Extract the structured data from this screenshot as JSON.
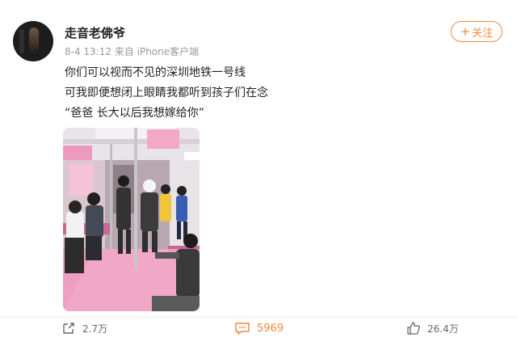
{
  "post": {
    "author": {
      "name": "走音老佛爷",
      "avatar": "avatar-photo-dark"
    },
    "meta": "8-4 13:12  来自 iPhone客户端",
    "follow_label": "关注",
    "text_lines": [
      "你们可以视而不见的深圳地铁一号线",
      "可我即便想闭上眼睛我都听到孩子们在念",
      "“爸爸 长大以后我想嫁给你”"
    ],
    "image": {
      "description_icon": "subway-car-photo"
    }
  },
  "actions": {
    "share": {
      "icon": "share-icon",
      "count": "2.7万"
    },
    "comment": {
      "icon": "comment-icon",
      "count": "5969",
      "accent": "#f08a3c"
    },
    "like": {
      "icon": "thumbs-up-icon",
      "count": "26.4万"
    }
  },
  "colors": {
    "accent": "#f08a3c",
    "text": "#222222",
    "meta": "#999999"
  }
}
